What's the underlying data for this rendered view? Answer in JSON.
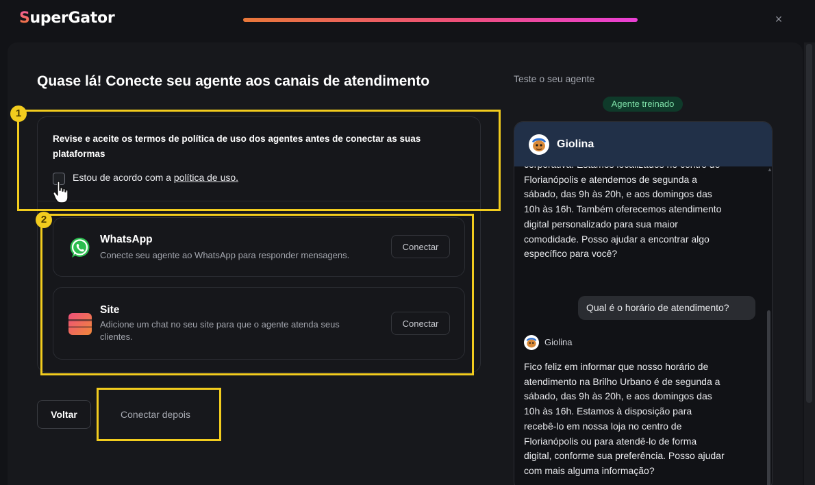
{
  "app": {
    "logo_first": "S",
    "logo_rest": "uperGator",
    "close_icon": "×"
  },
  "onboarding": {
    "progress_fraction": 1.0,
    "title": "Quase lá! Conecte seu agente aos canais de atendimento",
    "terms_text": "Revise e aceite os termos de política de uso dos agentes antes de conectar as suas plataformas",
    "agree_prefix": "Estou de acordo com a ",
    "agree_link": "política de uso.",
    "agree_checked": false,
    "channels": [
      {
        "name": "WhatsApp",
        "description": "Conecte seu agente ao WhatsApp para responder mensagens.",
        "icon": "whatsapp-icon",
        "button": "Conectar"
      },
      {
        "name": "Site",
        "description": "Adicione um chat no seu site para que o agente atenda seus clientes.",
        "icon": "site-chat-icon",
        "button": "Conectar"
      }
    ],
    "back_label": "Voltar",
    "later_label": "Conectar depois"
  },
  "annotations": {
    "badge_1": "1",
    "badge_2": "2",
    "highlight_color": "#f2cc1e"
  },
  "preview": {
    "label": "Teste o seu agente",
    "status": "Agente treinado",
    "agent_name": "Giolina",
    "messages": {
      "bot_1_partial": "corporativa. Estamos localizados no centro de Florianópolis e atendemos de segunda a sábado, das 9h às 20h, e aos domingos das 10h às 16h. Também oferecemos atendimento digital personalizado para sua maior comodidade. Posso ajudar a encontrar algo específico para você?",
      "user_1": "Qual é o horário de atendimento?",
      "bot_2_sender": "Giolina",
      "bot_2": "Fico feliz em informar que nosso horário de atendimento na Brilho Urbano é de segunda a sábado, das 9h às 20h, e aos domingos das 10h às 16h. Estamos à disposição para recebê-lo em nossa loja no centro de Florianópolis ou para atendê-lo de forma digital, conforme sua preferência. Posso ajudar com mais alguma informação?"
    }
  },
  "colors": {
    "accent_gradient_start": "#e9783a",
    "accent_gradient_end": "#ea3fd6",
    "chat_header": "#213048",
    "status_green": "#7ee0a8"
  }
}
